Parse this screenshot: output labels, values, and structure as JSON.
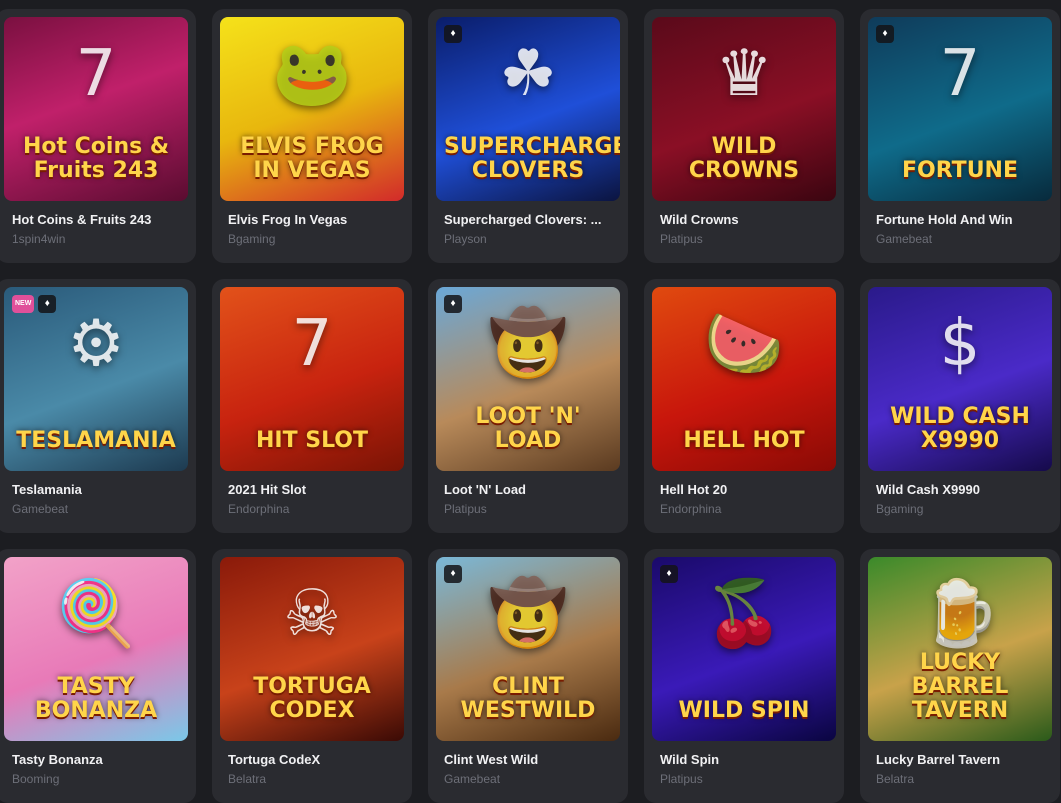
{
  "games": [
    {
      "title": "Hot Coins & Fruits 243",
      "provider": "1spin4win",
      "art": "Hot Coins & Fruits 243",
      "glyph": "7",
      "bg": "linear-gradient(160deg,#7a1040,#c0206a 45%,#5a0c30)",
      "badges": []
    },
    {
      "title": "Elvis Frog In Vegas",
      "provider": "Bgaming",
      "art": "ELVIS FROG IN VEGAS",
      "glyph": "🐸",
      "bg": "linear-gradient(160deg,#f5e21a,#e8b70e 50%,#d22a2a)",
      "badges": []
    },
    {
      "title": "Supercharged Clovers: ...",
      "provider": "Playson",
      "art": "SUPERCHARGED CLOVERS",
      "glyph": "☘",
      "bg": "linear-gradient(160deg,#0a1d6a,#1f4fd8 55%,#0b1440)",
      "badges": [
        "diamond-icon"
      ]
    },
    {
      "title": "Wild Crowns",
      "provider": "Platipus",
      "art": "WILD CROWNS",
      "glyph": "♛",
      "bg": "linear-gradient(160deg,#5a0a1a,#8a0f25 55%,#3a0510)",
      "badges": []
    },
    {
      "title": "Fortune Hold And Win",
      "provider": "Gamebeat",
      "art": "FORTUNE",
      "glyph": "7",
      "bg": "linear-gradient(160deg,#0f3b5a,#0f6b8a 55%,#072a3c)",
      "badges": [
        "diamond-icon"
      ]
    },
    {
      "title": "Teslamania",
      "provider": "Gamebeat",
      "art": "TESLAMANIA",
      "glyph": "⚙",
      "bg": "linear-gradient(160deg,#2a5a7a,#4a8aa8 55%,#1d3a50)",
      "badges": [
        "new",
        "diamond-icon"
      ]
    },
    {
      "title": "2021 Hit Slot",
      "provider": "Endorphina",
      "art": "HIT SLOT",
      "glyph": "7",
      "bg": "linear-gradient(160deg,#e2521a,#c8230f 55%,#7a1405)",
      "badges": []
    },
    {
      "title": "Loot 'N' Load",
      "provider": "Platipus",
      "art": "LOOT 'N' LOAD",
      "glyph": "🤠",
      "bg": "linear-gradient(160deg,#6aa8d8,#b88a5a 55%,#5a3a20)",
      "badges": [
        "diamond-icon"
      ]
    },
    {
      "title": "Hell Hot 20",
      "provider": "Endorphina",
      "art": "HELL HOT",
      "glyph": "🍉",
      "bg": "linear-gradient(160deg,#e04a0f,#c8160c 55%,#8a0a05)",
      "badges": []
    },
    {
      "title": "Wild Cash X9990",
      "provider": "Bgaming",
      "art": "WILD CASH X9990",
      "glyph": "$",
      "bg": "linear-gradient(160deg,#2a1a8a,#4a2ac8 55%,#150a4a)",
      "badges": []
    },
    {
      "title": "Tasty Bonanza",
      "provider": "Booming",
      "art": "TASTY BONANZA",
      "glyph": "🍭",
      "bg": "linear-gradient(160deg,#f2a2c8,#e87ab8 55%,#7ac8e8)",
      "badges": []
    },
    {
      "title": "Tortuga CodeX",
      "provider": "Belatra",
      "art": "TORTUGA CODEX",
      "glyph": "☠",
      "bg": "linear-gradient(160deg,#8a1a0a,#c8421a 55%,#3a0a05)",
      "badges": []
    },
    {
      "title": "Clint West Wild",
      "provider": "Gamebeat",
      "art": "CLINT WESTWILD",
      "glyph": "🤠",
      "bg": "linear-gradient(160deg,#7ab8d8,#a87a4a 55%,#4a2a10)",
      "badges": [
        "diamond-icon"
      ]
    },
    {
      "title": "Wild Spin",
      "provider": "Platipus",
      "art": "WILD SPIN",
      "glyph": "🍒",
      "bg": "linear-gradient(160deg,#1a0a6a,#3a1ab8 55%,#0a0540)",
      "badges": [
        "diamond-icon"
      ]
    },
    {
      "title": "Lucky Barrel Tavern",
      "provider": "Belatra",
      "art": "LUCKY BARREL TAVERN",
      "glyph": "🍺",
      "bg": "linear-gradient(160deg,#3a8a2a,#c8a24a 55%,#2a5a1a)",
      "badges": []
    }
  ]
}
